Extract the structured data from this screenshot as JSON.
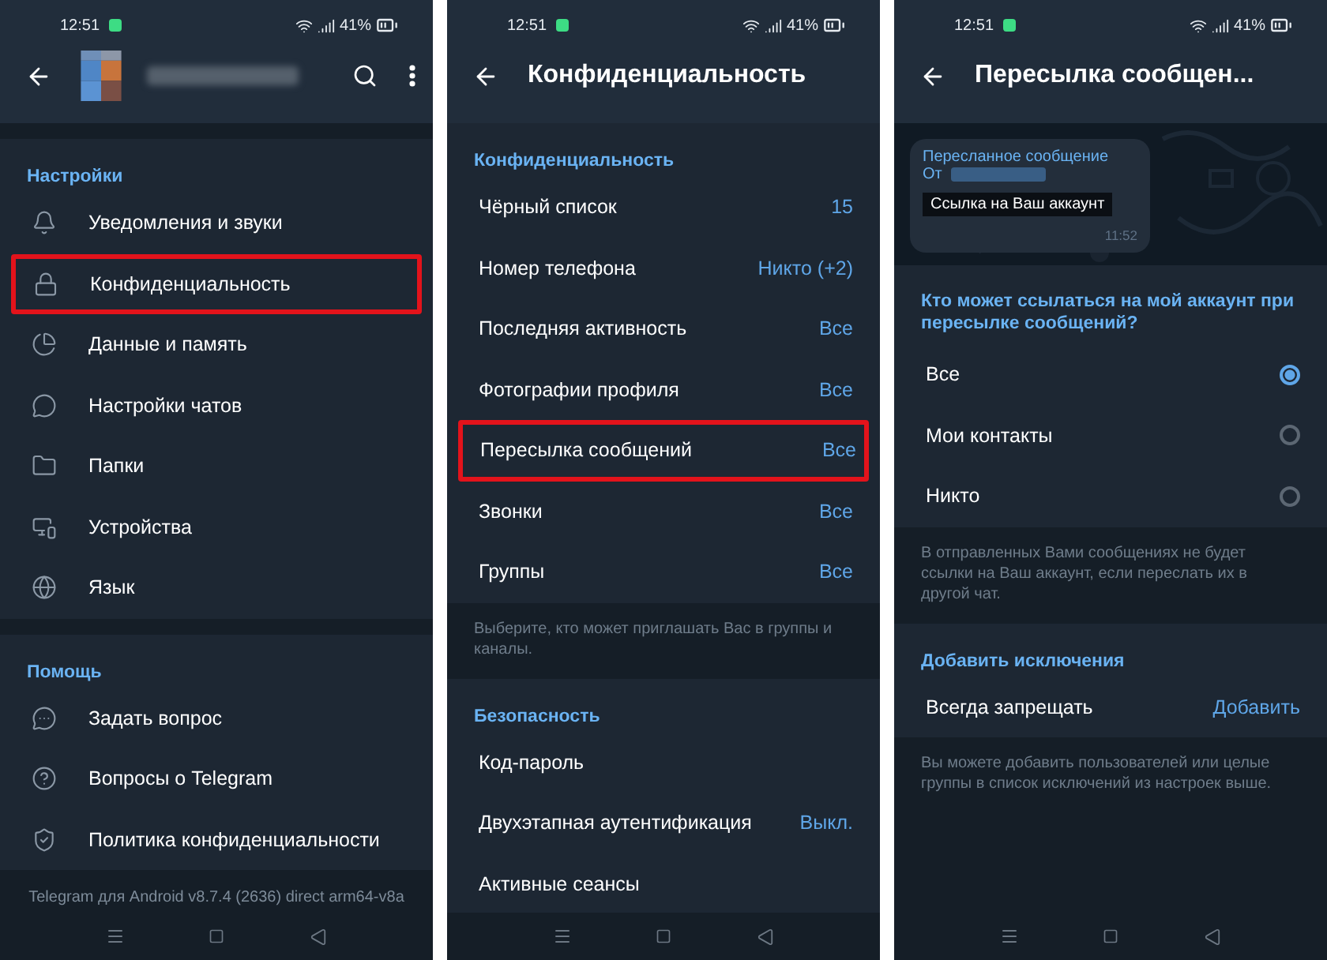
{
  "screens": [
    {
      "kind": "settings_menu",
      "status_bar": {
        "time": "12:51",
        "battery": "41%"
      },
      "sections": [
        {
          "title": "Настройки",
          "items": [
            {
              "label": "Уведомления и звуки",
              "highlighted": false
            },
            {
              "label": "Конфиденциальность",
              "highlighted": true
            },
            {
              "label": "Данные и память",
              "highlighted": false
            },
            {
              "label": "Настройки чатов",
              "highlighted": false
            },
            {
              "label": "Папки",
              "highlighted": false
            },
            {
              "label": "Устройства",
              "highlighted": false
            },
            {
              "label": "Язык",
              "highlighted": false
            }
          ]
        },
        {
          "title": "Помощь",
          "items": [
            {
              "label": "Задать вопрос",
              "highlighted": false
            },
            {
              "label": "Вопросы о Telegram",
              "highlighted": false
            },
            {
              "label": "Политика конфиденциальности",
              "highlighted": false
            }
          ]
        }
      ],
      "footer": "Telegram для Android v8.7.4 (2636) direct arm64-v8a"
    },
    {
      "kind": "privacy",
      "status_bar": {
        "time": "12:51",
        "battery": "41%"
      },
      "title": "Конфиденциальность",
      "sections": [
        {
          "title": "Конфиденциальность",
          "items": [
            {
              "label": "Чёрный список",
              "value": "15",
              "highlighted": false
            },
            {
              "label": "Номер телефона",
              "value": "Никто (+2)",
              "highlighted": false
            },
            {
              "label": "Последняя активность",
              "value": "Все",
              "highlighted": false
            },
            {
              "label": "Фотографии профиля",
              "value": "Все",
              "highlighted": false
            },
            {
              "label": "Пересылка сообщений",
              "value": "Все",
              "highlighted": true
            },
            {
              "label": "Звонки",
              "value": "Все",
              "highlighted": false
            },
            {
              "label": "Группы",
              "value": "Все",
              "highlighted": false
            }
          ],
          "hint": "Выберите, кто может приглашать Вас в группы и каналы."
        },
        {
          "title": "Безопасность",
          "items": [
            {
              "label": "Код-пароль",
              "highlighted": false
            },
            {
              "label": "Двухэтапная аутентификация",
              "value": "Выкл.",
              "highlighted": false
            },
            {
              "label": "Активные сеансы",
              "highlighted": false
            }
          ]
        }
      ]
    },
    {
      "kind": "forwarding",
      "status_bar": {
        "time": "12:51",
        "battery": "41%"
      },
      "title": "Пересылка сообщен...",
      "preview": {
        "header": "Пересланное сообщение",
        "from": "От",
        "tooltip": "Ссылка на Ваш аккаунт",
        "time": "11:52"
      },
      "question": "Кто может ссылаться на мой аккаунт при пересылке сообщений?",
      "options": [
        {
          "label": "Все",
          "selected": true
        },
        {
          "label": "Мои контакты",
          "selected": false
        },
        {
          "label": "Никто",
          "selected": false
        }
      ],
      "hint": "В отправленных Вами сообщениях не будет ссылки на Ваш аккаунт, если переслать их в другой чат.",
      "exceptions": {
        "title": "Добавить исключения",
        "items": [
          {
            "label": "Всегда запрещать",
            "action": "Добавить"
          }
        ],
        "hint": "Вы можете добавить пользователей или целые группы в список исключений из настроек выше."
      }
    }
  ]
}
